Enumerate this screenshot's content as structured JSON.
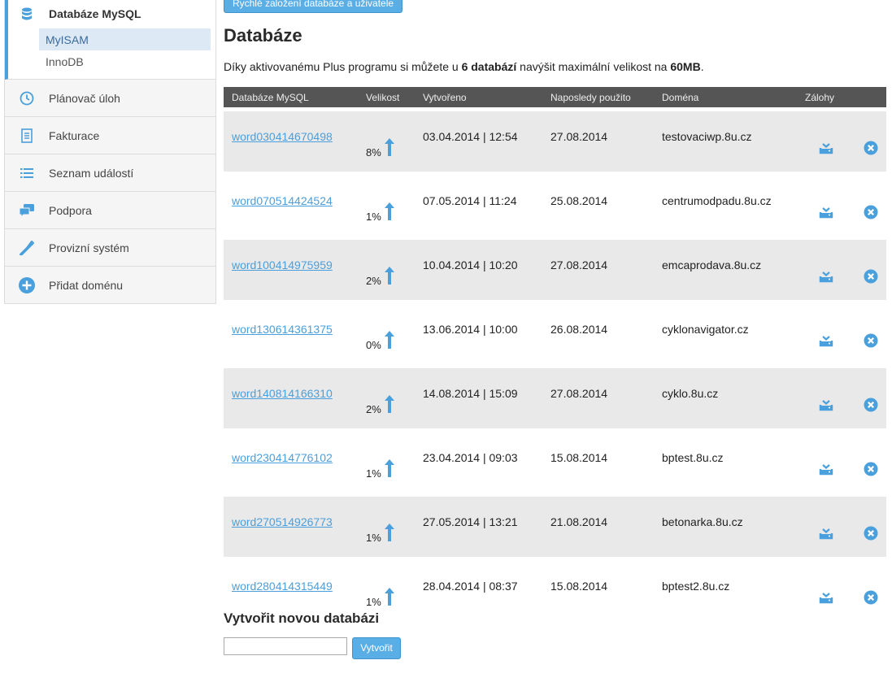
{
  "sidebar": {
    "active": {
      "label": "Databáze MySQL",
      "icon": "database-icon",
      "subitems": [
        {
          "label": "MyISAM",
          "selected": true
        },
        {
          "label": "InnoDB",
          "selected": false
        }
      ]
    },
    "items": [
      {
        "label": "Plánovač úloh",
        "icon": "clock-icon"
      },
      {
        "label": "Fakturace",
        "icon": "invoice-icon"
      },
      {
        "label": "Seznam událostí",
        "icon": "list-icon"
      },
      {
        "label": "Podpora",
        "icon": "chat-icon"
      },
      {
        "label": "Provizní systém",
        "icon": "tag-icon"
      },
      {
        "label": "Přidat doménu",
        "icon": "plus-circle-icon"
      }
    ]
  },
  "top_button": {
    "label": "Rychlé založení databáze a uživatele"
  },
  "page": {
    "title": "Databáze",
    "info_pre": "Díky aktivovanému Plus programu si můžete u ",
    "info_bold1": "6 databází",
    "info_mid": " navýšit maximální velikost na ",
    "info_bold2": "60MB",
    "info_post": "."
  },
  "table": {
    "headers": [
      "Databáze MySQL",
      "Velikost",
      "Vytvořeno",
      "Naposledy použito",
      "Doména",
      "Zálohy"
    ],
    "rows": [
      {
        "name": "word030414670498",
        "size": "8%",
        "created": "03.04.2014 | 12:54",
        "last_used": "27.08.2014",
        "domain": "testovaciwp.8u.cz"
      },
      {
        "name": "word070514424524",
        "size": "1%",
        "created": "07.05.2014 | 11:24",
        "last_used": "25.08.2014",
        "domain": "centrumodpadu.8u.cz"
      },
      {
        "name": "word100414975959",
        "size": "2%",
        "created": "10.04.2014 | 10:20",
        "last_used": "27.08.2014",
        "domain": "emcaprodava.8u.cz"
      },
      {
        "name": "word130614361375",
        "size": "0%",
        "created": "13.06.2014 | 10:00",
        "last_used": "26.08.2014",
        "domain": "cyklonavigator.cz"
      },
      {
        "name": "word140814166310",
        "size": "2%",
        "created": "14.08.2014 | 15:09",
        "last_used": "27.08.2014",
        "domain": "cyklo.8u.cz"
      },
      {
        "name": "word230414776102",
        "size": "1%",
        "created": "23.04.2014 | 09:03",
        "last_used": "15.08.2014",
        "domain": "bptest.8u.cz"
      },
      {
        "name": "word270514926773",
        "size": "1%",
        "created": "27.05.2014 | 13:21",
        "last_used": "21.08.2014",
        "domain": "betonarka.8u.cz"
      },
      {
        "name": "word280414315449",
        "size": "1%",
        "created": "28.04.2014 | 08:37",
        "last_used": "15.08.2014",
        "domain": "bptest2.8u.cz"
      }
    ]
  },
  "new_db": {
    "title": "Vytvořit novou databázi",
    "input_value": "",
    "button_label": "Vytvořit"
  },
  "colors": {
    "accent": "#4aa0dc",
    "header_bg": "#555555",
    "row_alt": "#e9e9e9"
  }
}
